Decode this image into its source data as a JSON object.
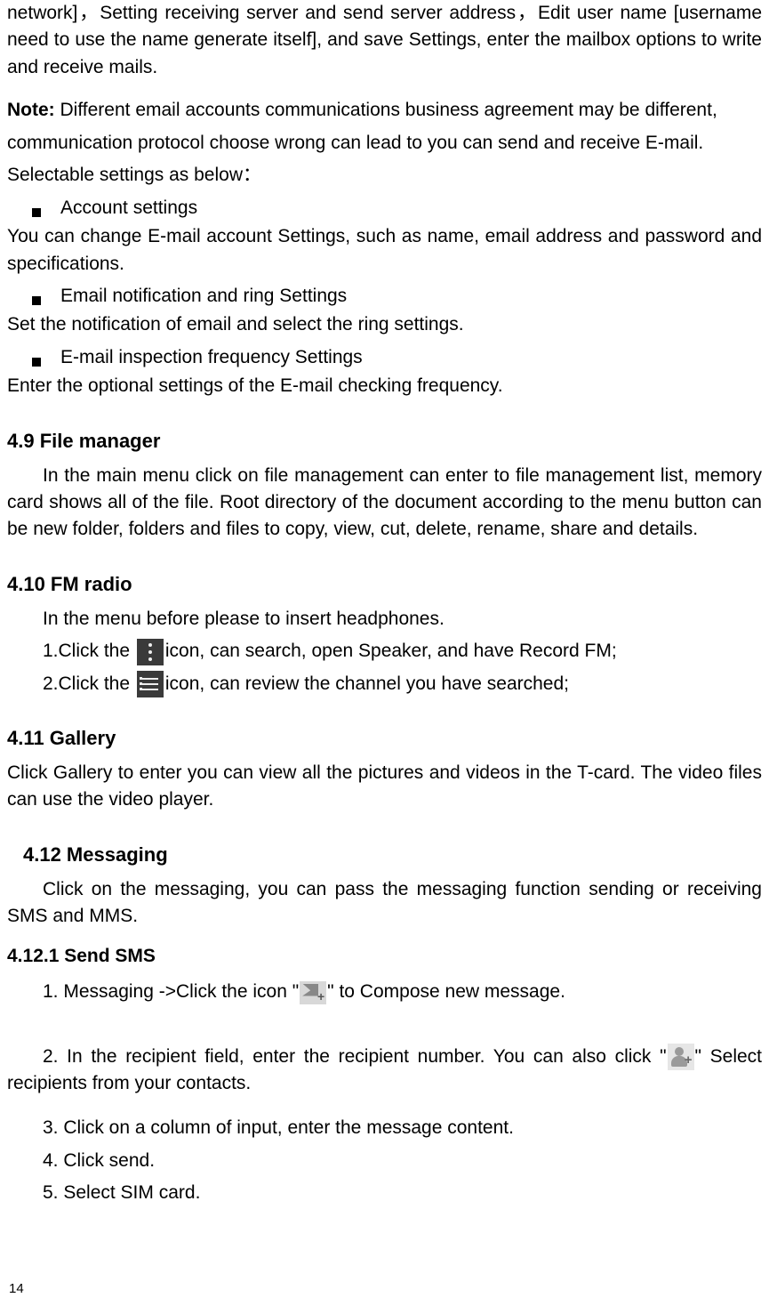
{
  "intro": "network]，Setting receiving server and send server address，Edit user name [username need to use the name generate itself], and save Settings, enter the mailbox options to write and receive mails.",
  "note_label": "Note:",
  "note_text_1": " Different email accounts communications business agreement may be different,",
  "note_text_2": "communication protocol choose wrong can lead to you can send and receive E-mail.",
  "selectable_line": "Selectable settings as below：",
  "bullets": {
    "b1": "Account settings",
    "b1_desc": "You can change E-mail account Settings, such as name, email address and password and specifications.",
    "b2": "Email notification and ring Settings",
    "b2_desc": "Set the notification of email and select the ring settings.",
    "b3": "E-mail inspection frequency Settings",
    "b3_desc": "Enter the optional settings of the E-mail checking frequency."
  },
  "sec49_title": "4.9    File manager",
  "sec49_body": "In the main menu click on file management can enter to file management list, memory card shows all of the file. Root directory of the document according to the menu button can be new folder, folders and files to copy, view, cut, delete, rename, share and details.",
  "sec410_title": "4.10  FM radio",
  "sec410_intro": "In the menu before please to insert headphones.",
  "sec410_l1a": "1.Click the ",
  "sec410_l1b": "icon, can search, open Speaker, and have Record FM;",
  "sec410_l2a": "2.Click the ",
  "sec410_l2b": "icon, can review the channel you have searched;",
  "sec411_title": "4.11  Gallery",
  "sec411_body": "Click Gallery to enter you can view all the pictures and videos in the T-card. The video files can use the video player.",
  "sec412_title": "4.12  Messaging",
  "sec412_body": "Click on the messaging, you can pass the messaging function sending or receiving SMS and MMS.",
  "sec4121_title": "4.12.1  Send SMS",
  "step1a": "1. Messaging ->Click the icon \"",
  "step1b": "\" to Compose new message.",
  "step2a": "2. In the recipient field, enter the recipient number. You can also click \"",
  "step2b": "\" Select recipients from your contacts.",
  "step3": "3. Click on a column of input, enter the message content.",
  "step4": "4. Click send.",
  "step5": "5. Select SIM card.",
  "page_number": "14"
}
